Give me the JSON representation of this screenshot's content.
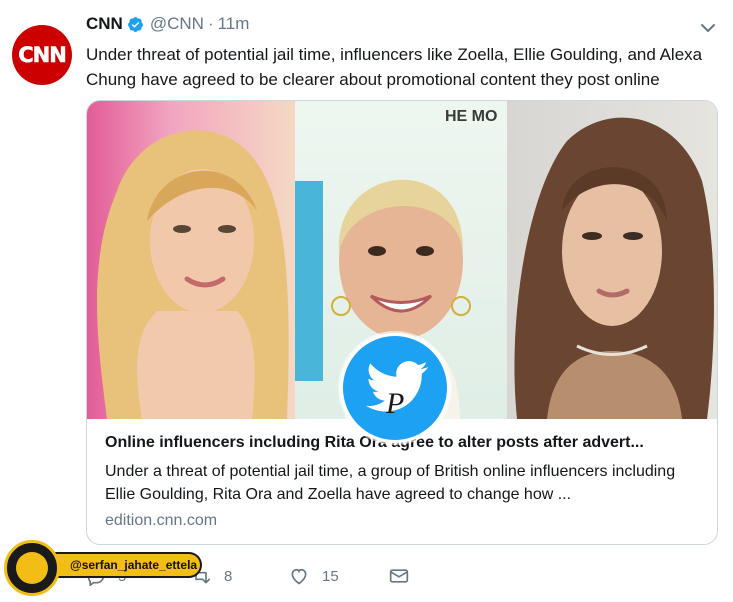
{
  "tweet": {
    "avatar_text": "CNN",
    "name": "CNN",
    "handle": "@CNN",
    "separator": "·",
    "time": "11m",
    "text": "Under threat of potential jail time, influencers like Zoella, Ellie Goulding, and Alexa Chung have agreed to be clearer about promotional content they post online"
  },
  "card": {
    "title": "Online influencers including Rita Ora agree to alter posts after advert...",
    "description": "Under a threat of potential jail time, a group of British online influencers including Ellie Goulding, Rita Ora and Zoella have agreed to change how ...",
    "domain": "edition.cnn.com"
  },
  "actions": {
    "reply_count": "5",
    "retweet_count": "8",
    "like_count": "15"
  },
  "watermark": {
    "handle": "@serfan_jahate_ettela"
  },
  "colors": {
    "brand_red": "#cc0000",
    "twitter_blue": "#1da1f2",
    "muted": "#657786",
    "watermark_yellow": "#f2bd14"
  }
}
